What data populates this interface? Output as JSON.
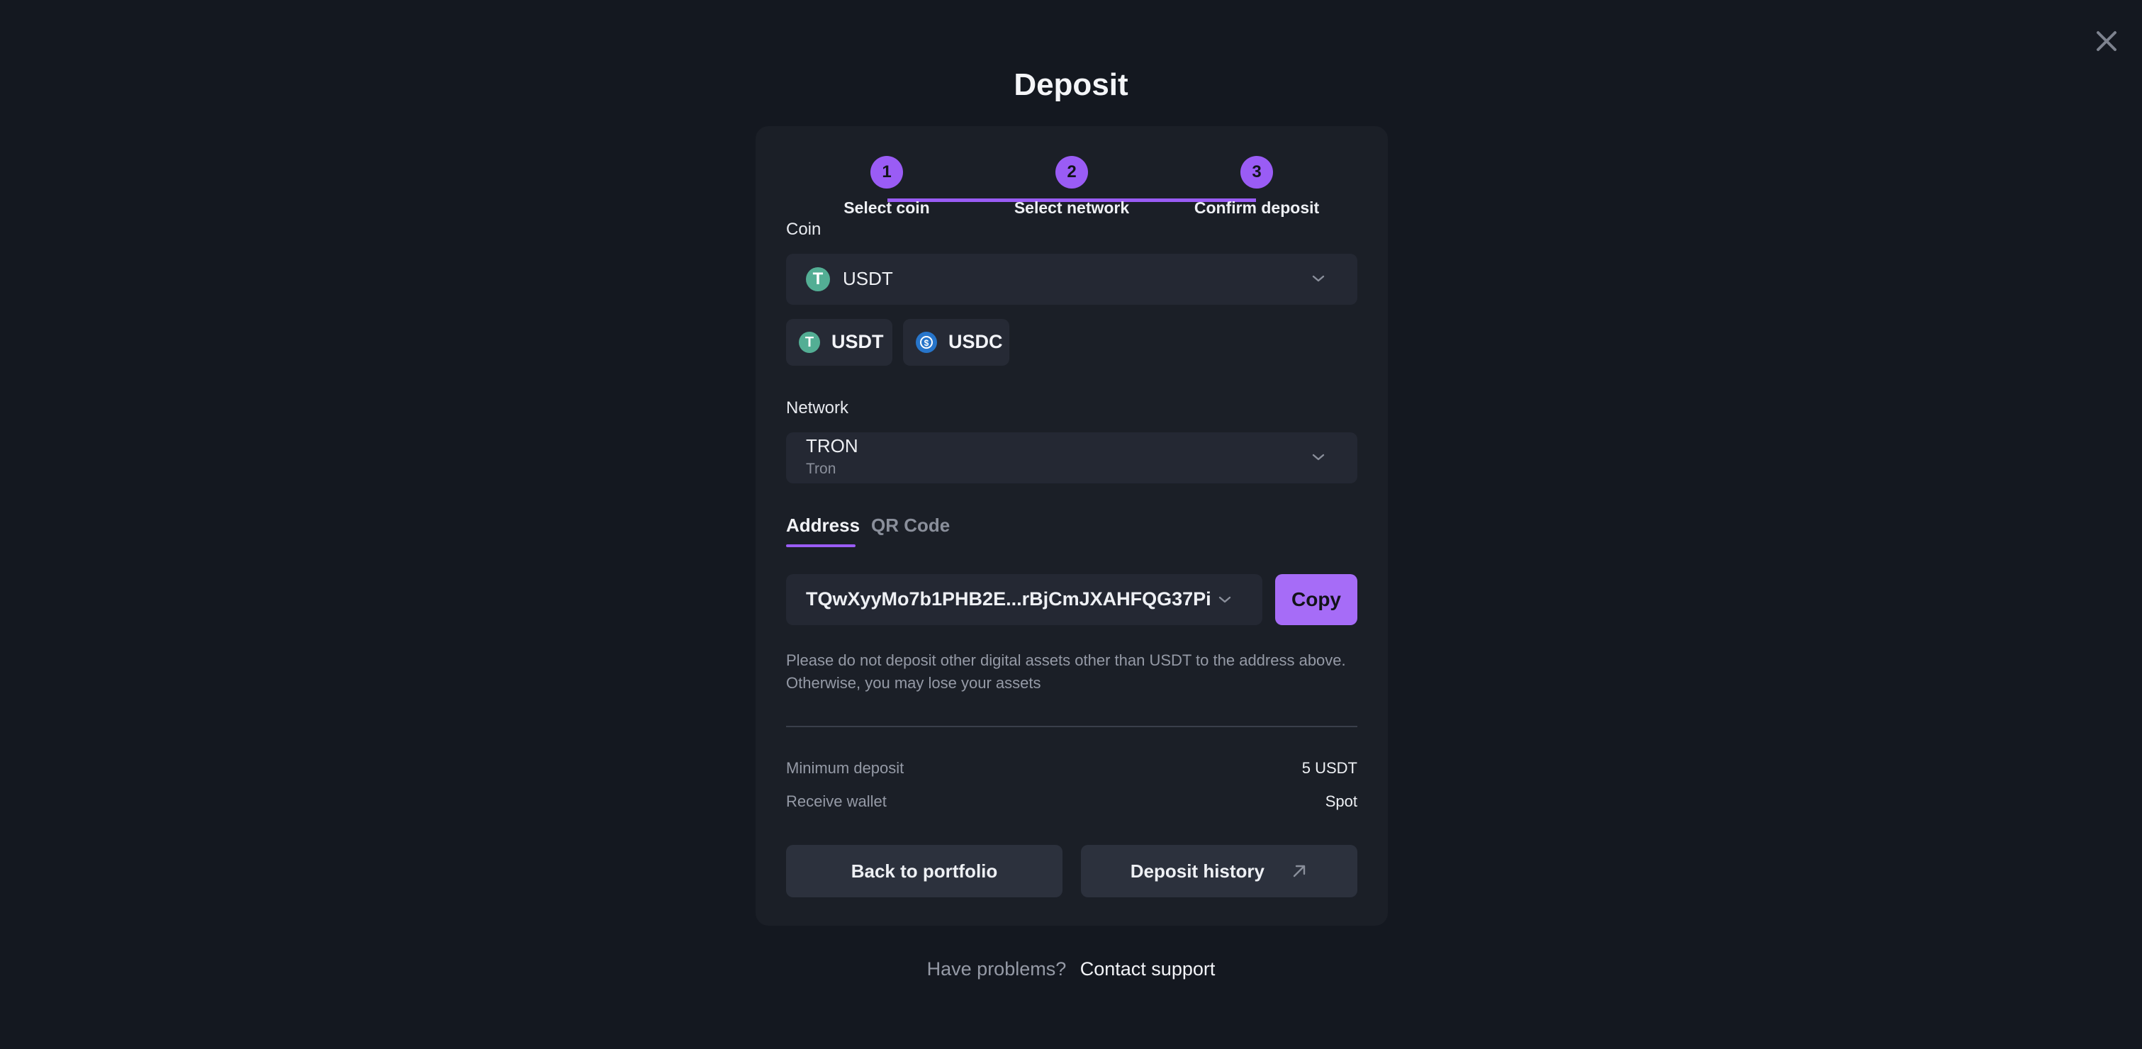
{
  "colors": {
    "background": "#141820",
    "card": "#1b1f27",
    "accent": "#9a5cf5",
    "copy_button": "#a66cf7",
    "usdt": "#53ae94",
    "usdc": "#2775ca"
  },
  "modal": {
    "title": "Deposit",
    "close_icon": "close-icon"
  },
  "stepper": {
    "steps": [
      {
        "number": "1",
        "label": "Select coin"
      },
      {
        "number": "2",
        "label": "Select network"
      },
      {
        "number": "3",
        "label": "Confirm deposit"
      }
    ]
  },
  "coin": {
    "label": "Coin",
    "selected": "USDT",
    "selected_icon": "tether-icon",
    "quick_picks": [
      {
        "label": "USDT",
        "icon": "tether-icon"
      },
      {
        "label": "USDC",
        "icon": "usdc-icon"
      }
    ]
  },
  "network": {
    "label": "Network",
    "selected": "TRON",
    "selected_sub": "Tron"
  },
  "tabs": [
    {
      "label": "Address",
      "active": true
    },
    {
      "label": "QR Code",
      "active": false
    }
  ],
  "address": {
    "value": "TQwXyyMo7b1PHB2E...rBjCmJXAHFQG37Pi",
    "copy_label": "Copy"
  },
  "warning": {
    "line1": "Please do not deposit other digital assets other than USDT to the address above.",
    "line2": "Otherwise, you may lose your assets"
  },
  "info": [
    {
      "key": "Minimum deposit",
      "value": "5 USDT"
    },
    {
      "key": "Receive wallet",
      "value": "Spot"
    }
  ],
  "actions": {
    "back": "Back to portfolio",
    "history": "Deposit history"
  },
  "help": {
    "question": "Have problems?",
    "link": "Contact support"
  }
}
